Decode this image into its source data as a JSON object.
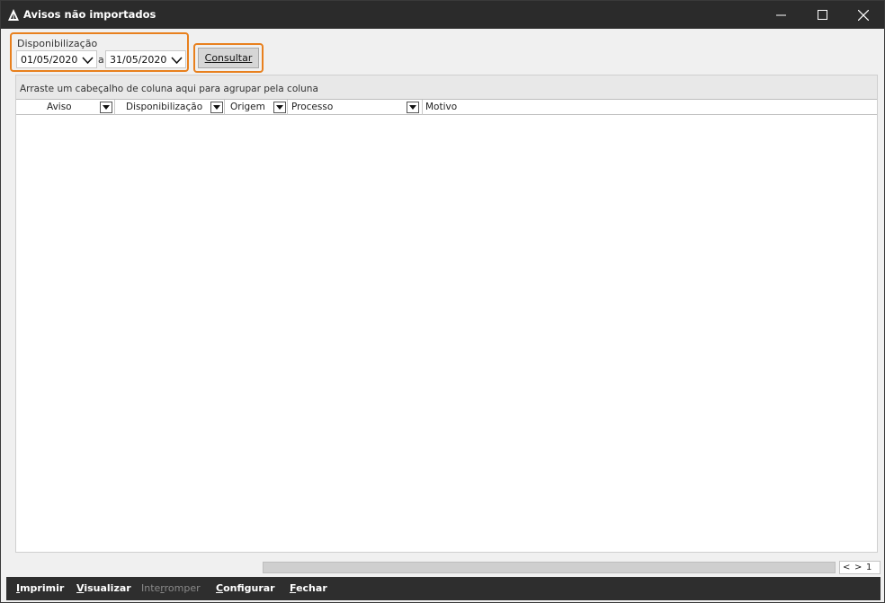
{
  "window": {
    "title": "Avisos não importados"
  },
  "filter": {
    "label": "Disponibilização",
    "date_from": "01/05/2020",
    "separator": "a",
    "date_to": "31/05/2020",
    "consultar_prefix": "C",
    "consultar_rest": "onsultar"
  },
  "grid": {
    "group_hint": "Arraste um cabeçalho de coluna aqui para agrupar pela coluna",
    "columns": [
      {
        "label": "Aviso"
      },
      {
        "label": "Disponibilização"
      },
      {
        "label": "Origem"
      },
      {
        "label": "Processo"
      },
      {
        "label": "Motivo"
      }
    ]
  },
  "pager": {
    "prev": "<",
    "next": ">",
    "page": "1"
  },
  "toolbar": {
    "imprimir_key": "I",
    "imprimir_rest": "mprimir",
    "visualizar_key": "V",
    "visualizar_rest": "isualizar",
    "interromper_pre": "Inte",
    "interromper_key": "r",
    "interromper_rest": "romper",
    "configurar_key": "C",
    "configurar_rest": "onfigurar",
    "fechar_key": "F",
    "fechar_rest": "echar"
  },
  "colors": {
    "titlebar": "#2b2b2b",
    "highlight": "#e8801e",
    "toolbar": "#2e2e2e"
  },
  "icons": {
    "app": "app-logo-icon",
    "minimize": "minimize-icon",
    "maximize": "maximize-icon",
    "close": "close-icon",
    "dropdown": "chevron-down-icon",
    "column_filter": "filter-dropdown-icon"
  }
}
